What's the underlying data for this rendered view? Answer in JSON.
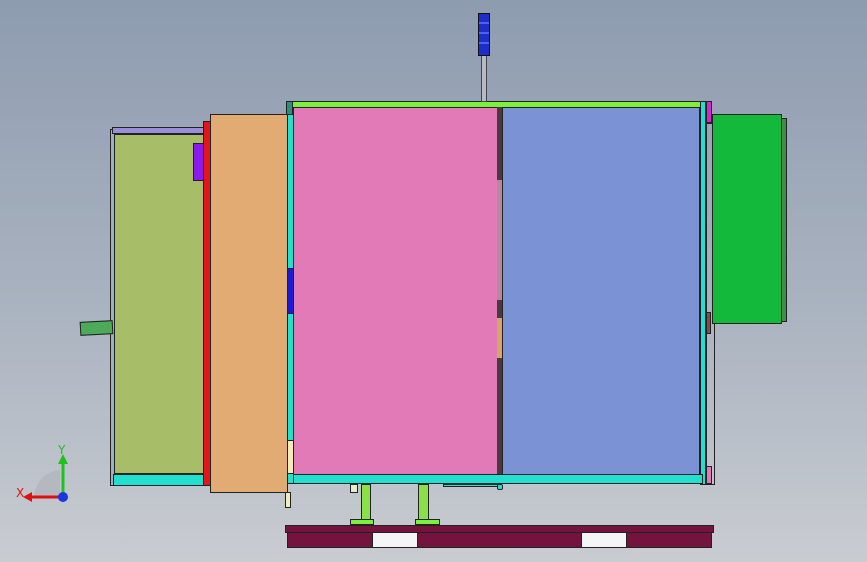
{
  "viewport": {
    "title": ""
  },
  "triad": {
    "x_label": "X",
    "y_label": "Y"
  },
  "colors": {
    "bg_top": "#8e9cb0",
    "bg_bottom": "#c9ccd1",
    "olive_panel": "#a8bd68",
    "orange_panel": "#e3ab74",
    "pink_panel": "#e27ab8",
    "blue_panel": "#7b93d5",
    "green_box": "#13b93b",
    "frame_green": "#7cf03d",
    "frame_cyan": "#22e0cf",
    "pallet": "#74133d",
    "red_strip": "#e0161b",
    "axis_x": "#e01010",
    "axis_y": "#1ec21e",
    "axis_z": "#1a36e0"
  }
}
